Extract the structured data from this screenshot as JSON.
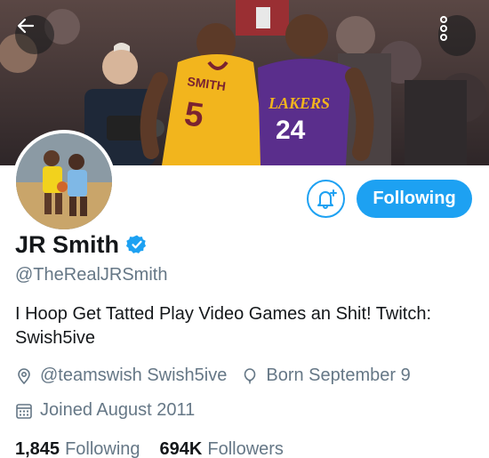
{
  "profile": {
    "display_name": "JR Smith",
    "handle": "@TheRealJRSmith",
    "bio": "I Hoop Get Tatted Play Video Games an Shit! Twitch: Swish5ive",
    "website": "@teamswish Swish5ive",
    "birthday": "Born September 9",
    "joined": "Joined August 2011",
    "verified": true
  },
  "stats": {
    "following_count": "1,845",
    "following_label": "Following",
    "followers_count": "694K",
    "followers_label": "Followers"
  },
  "actions": {
    "following_button": "Following"
  },
  "banner": {
    "jersey_left_name": "SMITH",
    "jersey_left_number": "5",
    "jersey_right_team": "LAKERS",
    "jersey_right_number": "24"
  },
  "colors": {
    "accent": "#1da1f2",
    "text_primary": "#14171a",
    "text_secondary": "#657786"
  },
  "icons": {
    "back": "arrow-left-icon",
    "more": "more-vertical-icon",
    "notify": "bell-plus-icon",
    "verified": "verified-badge-icon",
    "location": "location-pin-icon",
    "birthday": "balloon-icon",
    "calendar": "calendar-icon"
  }
}
